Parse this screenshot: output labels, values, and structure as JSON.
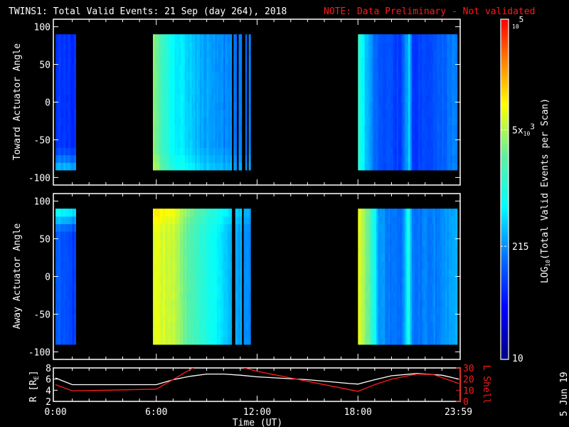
{
  "title": {
    "main": "TWINS1: Total Valid Events: 21 Sep (day 264), 2018",
    "note": "NOTE: Data Preliminary - Not validated"
  },
  "date_stamp": "5 Jun 19",
  "colors": {
    "background": "#000000",
    "axes": "#ffffff",
    "note": "#ff1a1a",
    "lshell": "#ff1a1a",
    "radius": "#ffffff"
  },
  "chart_data": [
    {
      "type": "heatmap",
      "panel": "top",
      "ylabel": "Toward Actuator Angle",
      "ylim": [
        -110,
        110
      ],
      "yticks": [
        "100",
        "50",
        "0",
        "-50",
        "-100"
      ],
      "ytick_values": [
        100,
        50,
        0,
        -50,
        -100
      ],
      "xlim_hours": [
        0,
        24
      ],
      "angle_range": [
        -90,
        90
      ],
      "blocks": [
        {
          "start": 0.0,
          "end": 1.15,
          "profile": [
            [
              0,
              1.9
            ],
            [
              1.15,
              1.8
            ]
          ],
          "edge_angle": -90,
          "edge_boost": 0.7
        },
        {
          "start": 5.8,
          "end": 11.5,
          "profile": [
            [
              5.8,
              3.6
            ],
            [
              6.3,
              3.2
            ],
            [
              7.0,
              2.8
            ],
            [
              8.5,
              2.5
            ],
            [
              10.0,
              2.3
            ],
            [
              11.5,
              2.2
            ]
          ],
          "edge_angle": -90,
          "edge_boost": 0.2
        },
        {
          "start": 18.0,
          "end": 23.9,
          "profile": [
            [
              18.0,
              3.1
            ],
            [
              18.4,
              2.6
            ],
            [
              19.0,
              2.1
            ],
            [
              20.5,
              1.9
            ],
            [
              21.0,
              2.6
            ],
            [
              21.2,
              1.9
            ],
            [
              23.0,
              2.1
            ],
            [
              23.9,
              2.3
            ]
          ],
          "edge_angle": 90,
          "edge_boost": 0.0
        }
      ],
      "gaps": [
        [
          10.45,
          10.55
        ],
        [
          10.75,
          10.85
        ],
        [
          11.1,
          11.25
        ],
        [
          11.35,
          11.45
        ]
      ]
    },
    {
      "type": "heatmap",
      "panel": "bottom",
      "ylabel": "Away Actuator Angle",
      "ylim": [
        -110,
        110
      ],
      "yticks": [
        "100",
        "50",
        "0",
        "-50",
        "-100"
      ],
      "ytick_values": [
        100,
        50,
        0,
        -50,
        -100
      ],
      "xlim_hours": [
        0,
        24
      ],
      "angle_range": [
        -90,
        90
      ],
      "blocks": [
        {
          "start": 0.0,
          "end": 1.15,
          "profile": [
            [
              0,
              2.1
            ],
            [
              1.15,
              1.9
            ]
          ],
          "edge_angle": 90,
          "edge_boost": 0.9
        },
        {
          "start": 5.8,
          "end": 11.5,
          "profile": [
            [
              5.8,
              3.9
            ],
            [
              7.0,
              3.8
            ],
            [
              8.0,
              3.3
            ],
            [
              9.5,
              2.8
            ],
            [
              10.5,
              2.5
            ],
            [
              11.5,
              2.3
            ]
          ],
          "edge_angle": 90,
          "edge_boost": 0.2
        },
        {
          "start": 18.0,
          "end": 23.9,
          "profile": [
            [
              18.0,
              3.9
            ],
            [
              18.6,
              3.4
            ],
            [
              19.2,
              2.4
            ],
            [
              20.5,
              2.1
            ],
            [
              21.0,
              3.0
            ],
            [
              21.2,
              2.2
            ],
            [
              23.0,
              2.3
            ],
            [
              23.9,
              2.5
            ]
          ],
          "edge_angle": 90,
          "edge_boost": 0.0
        }
      ],
      "gaps": [
        [
          10.5,
          10.6
        ],
        [
          11.05,
          11.15
        ]
      ]
    },
    {
      "type": "line",
      "panel": "orbit",
      "xlabel": "Time (UT)",
      "xticks": [
        "0:00",
        "6:00",
        "12:00",
        "18:00",
        "23:59"
      ],
      "xtick_values": [
        0,
        6,
        12,
        18,
        23.98
      ],
      "ylabel_left": "R [R",
      "ylabel_left_sub": "E",
      "ylabel_left_end": "]",
      "ylim_left": [
        2,
        8
      ],
      "yticks_left": [
        "8",
        "6",
        "4",
        "2"
      ],
      "ytick_values_left": [
        8,
        6,
        4,
        2
      ],
      "ylabel_right": "L Shell",
      "ylim_right": [
        0,
        30
      ],
      "yticks_right": [
        "30",
        "20",
        "10",
        "0"
      ],
      "ytick_values_right": [
        30,
        20,
        10,
        0
      ],
      "series": [
        {
          "name": "R",
          "axis": "left",
          "x": [
            0,
            1,
            6,
            7,
            8,
            9,
            10,
            11,
            12,
            15,
            17.5,
            18,
            19,
            20,
            21.5,
            23,
            24
          ],
          "y": [
            6.2,
            5.0,
            5.0,
            5.9,
            6.5,
            6.9,
            6.9,
            6.7,
            6.4,
            5.9,
            5.2,
            5.1,
            5.9,
            6.6,
            7.0,
            6.7,
            6.0
          ]
        },
        {
          "name": "L Shell",
          "axis": "right",
          "x": [
            0,
            1,
            3,
            6,
            8.3,
            null,
            11,
            12,
            15,
            18,
            19,
            20,
            21.5,
            22.5,
            24
          ],
          "y": [
            15,
            9.5,
            10,
            11,
            31,
            null,
            31,
            27,
            18,
            9,
            15,
            20,
            24.5,
            24,
            16
          ]
        }
      ]
    },
    {
      "type": "colorbar",
      "label_prefix": "LOG",
      "label_sub": "10",
      "label_rest": "(Total Valid Events per Scan)",
      "log_range": [
        1,
        5
      ],
      "ticks": [
        {
          "label": "10",
          "log": 1
        },
        {
          "label": "215",
          "log": 2.33
        },
        {
          "label": "5x",
          "sub": "10",
          "sup": "3",
          "log": 3.7
        },
        {
          "label": "",
          "sub": "10",
          "sup": "5",
          "log": 5
        }
      ]
    }
  ]
}
